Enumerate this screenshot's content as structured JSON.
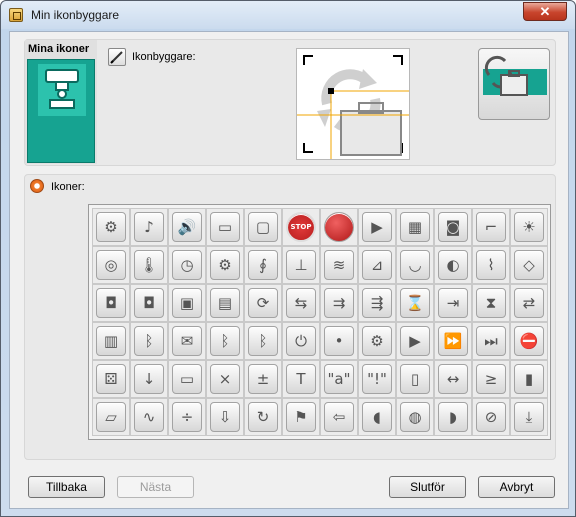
{
  "window": {
    "title": "Min ikonbyggare",
    "close_label": "✕"
  },
  "my_icons": {
    "label": "Mina ikoner"
  },
  "builder": {
    "label": "Ikonbyggare:"
  },
  "icons_section": {
    "label": "Ikoner:"
  },
  "icons": [
    {
      "name": "gear-icon",
      "glyph": "⚙"
    },
    {
      "name": "music-note-icon",
      "glyph": "♪"
    },
    {
      "name": "speaker-icon",
      "glyph": "🔊"
    },
    {
      "name": "flashlight-icon",
      "glyph": "▭"
    },
    {
      "name": "screen-icon",
      "glyph": "▢"
    },
    {
      "name": "stop-sign-icon",
      "glyph": "STOP",
      "style": "stop"
    },
    {
      "name": "red-ball-icon",
      "glyph": "",
      "style": "redball"
    },
    {
      "name": "play-icon",
      "glyph": "▶"
    },
    {
      "name": "chip-icon",
      "glyph": "▦"
    },
    {
      "name": "camera-icon",
      "glyph": "◙"
    },
    {
      "name": "faucet-icon",
      "glyph": "⌐"
    },
    {
      "name": "sun-icon",
      "glyph": "☀"
    },
    {
      "name": "rotation-sensor-icon",
      "glyph": "◎"
    },
    {
      "name": "thermometer-icon",
      "glyph": "🌡"
    },
    {
      "name": "timer-icon",
      "glyph": "◷"
    },
    {
      "name": "sound-sensor-icon",
      "glyph": "⚙"
    },
    {
      "name": "stethoscope-icon",
      "glyph": "∮"
    },
    {
      "name": "antenna-icon",
      "glyph": "⊥"
    },
    {
      "name": "waveform-icon",
      "glyph": "≋"
    },
    {
      "name": "satellite-dish-icon",
      "glyph": "⊿"
    },
    {
      "name": "dish-icon",
      "glyph": "◡"
    },
    {
      "name": "dial-icon",
      "glyph": "◐"
    },
    {
      "name": "microphone-icon",
      "glyph": "⌇"
    },
    {
      "name": "eye-icon",
      "glyph": "◇"
    },
    {
      "name": "motor-icon",
      "glyph": "◘"
    },
    {
      "name": "large-motor-icon",
      "glyph": "◘"
    },
    {
      "name": "brick-icon",
      "glyph": "▣"
    },
    {
      "name": "box-icon",
      "glyph": "▤"
    },
    {
      "name": "refresh-icon",
      "glyph": "⟳"
    },
    {
      "name": "split-arrows-icon",
      "glyph": "⇆"
    },
    {
      "name": "arrow-merge-icon",
      "glyph": "⇉"
    },
    {
      "name": "arrow-split-icon",
      "glyph": "⇶"
    },
    {
      "name": "hourglass-icon",
      "glyph": "⌛"
    },
    {
      "name": "forward-box-icon",
      "glyph": "⇥"
    },
    {
      "name": "hourglass-large-icon",
      "glyph": "⧗"
    },
    {
      "name": "transfer-icon",
      "glyph": "⇄"
    },
    {
      "name": "clipboard-icon",
      "glyph": "▥"
    },
    {
      "name": "bluetooth-icon",
      "glyph": "ᛒ"
    },
    {
      "name": "envelope-icon",
      "glyph": "✉"
    },
    {
      "name": "bluetooth-send-icon",
      "glyph": "ᛒ"
    },
    {
      "name": "bluetooth-receive-icon",
      "glyph": "ᛒ"
    },
    {
      "name": "power-icon",
      "glyph": "⏻"
    },
    {
      "name": "dot-icon",
      "glyph": "•"
    },
    {
      "name": "gear-small-icon",
      "glyph": "⚙"
    },
    {
      "name": "play-gear-icon",
      "glyph": "▶"
    },
    {
      "name": "fast-forward-gear-icon",
      "glyph": "⏩"
    },
    {
      "name": "skip-gear-icon",
      "glyph": "⏭"
    },
    {
      "name": "stop-gear-icon",
      "glyph": "⛔"
    },
    {
      "name": "dice-icon",
      "glyph": "⚄"
    },
    {
      "name": "download-arrow-icon",
      "glyph": "↓"
    },
    {
      "name": "briefcase-icon",
      "glyph": "▭"
    },
    {
      "name": "multiply-divide-icon",
      "glyph": "×"
    },
    {
      "name": "plus-minus-icon",
      "glyph": "±"
    },
    {
      "name": "text-t-icon",
      "glyph": "T"
    },
    {
      "name": "quote-a-icon",
      "glyph": "\"a\""
    },
    {
      "name": "quote-exclaim-icon",
      "glyph": "\"!\""
    },
    {
      "name": "battery-icon",
      "glyph": "▯"
    },
    {
      "name": "range-icon",
      "glyph": "↔"
    },
    {
      "name": "compare-icon",
      "glyph": "≥"
    },
    {
      "name": "switch-icon",
      "glyph": "▮"
    },
    {
      "name": "folder-open-icon",
      "glyph": "▱"
    },
    {
      "name": "heartbeat-icon",
      "glyph": "∿"
    },
    {
      "name": "calculator-icon",
      "glyph": "÷"
    },
    {
      "name": "down-arrow-icon",
      "glyph": "⇩"
    },
    {
      "name": "rotate-icon",
      "glyph": "↻"
    },
    {
      "name": "flag-icon",
      "glyph": "⚑"
    },
    {
      "name": "left-arrow-icon",
      "glyph": "⇦"
    },
    {
      "name": "sensor-left-icon",
      "glyph": "◖"
    },
    {
      "name": "sensor-round-icon",
      "glyph": "◍"
    },
    {
      "name": "sensor-right-icon",
      "glyph": "◗"
    },
    {
      "name": "no-entry-icon",
      "glyph": "⊘"
    },
    {
      "name": "import-icon",
      "glyph": "⤓"
    }
  ],
  "buttons": {
    "back": "Tillbaka",
    "next": "Nästa",
    "finish": "Slutför",
    "cancel": "Avbryt"
  }
}
